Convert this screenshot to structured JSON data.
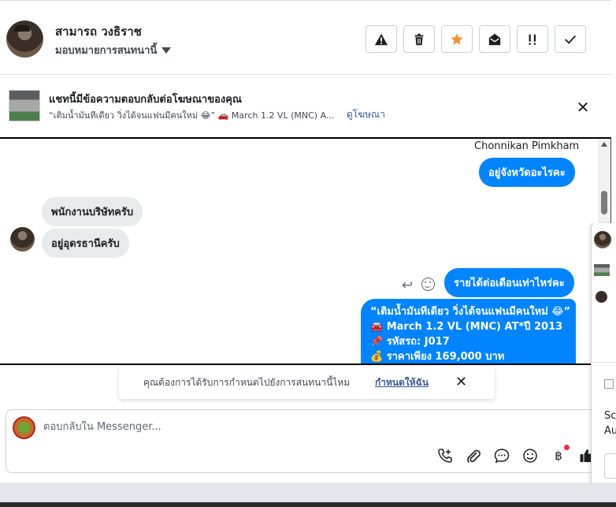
{
  "header": {
    "contact_name": "สามารถ วงธิราช",
    "assign_label": "มอบหมายการสนทนานี้"
  },
  "ad": {
    "title": "แชทนี้มีข้อความตอบกลับต่อโฆษณาของคุณ",
    "subtitle": "“เติมน้ำมันทีเดียว วิ่งได้จนแฟนมีคนใหม่ 😂” 🚗 March 1.2 VL (MNC) A...",
    "link": "ดูโฆษณา"
  },
  "chat": {
    "sender_name": "Chonnikan Pimkham",
    "messages": [
      {
        "direction": "out",
        "text": "อยู่จังหวัดอะไรคะ"
      },
      {
        "direction": "in",
        "text": "พนักงานบริษัทครับ"
      },
      {
        "direction": "in",
        "text": "อยู่อุดรธานีครับ"
      },
      {
        "direction": "out",
        "text": "รายได้ต่อเดือนเท่าไหร่คะ"
      }
    ],
    "ad_message_lines": [
      "“เติมน้ำมันทีเดียว วิ่งได้จนแฟนมีคนใหม่ 😂”",
      "🚘 March 1.2 VL (MNC) AT*ปี 2013",
      "📌 รหัสรถ: J017",
      "💰 ราคาเพียง 169,000 บาท"
    ]
  },
  "toast": {
    "text": "คุณต้องการได้รับการกำหนดไปยังการสนทนานี้ไหม",
    "link": "กำหนดให้ฉัน"
  },
  "composer": {
    "placeholder": "ตอบกลับใน Messenger..."
  },
  "side_panel": {
    "line1": "Sc",
    "line2": "Au"
  },
  "colors": {
    "outgoing_bubble": "#0084ff",
    "incoming_bubble": "#e9eaec",
    "link": "#385898",
    "star": "#f7923a",
    "notification_dot": "#f02849"
  }
}
